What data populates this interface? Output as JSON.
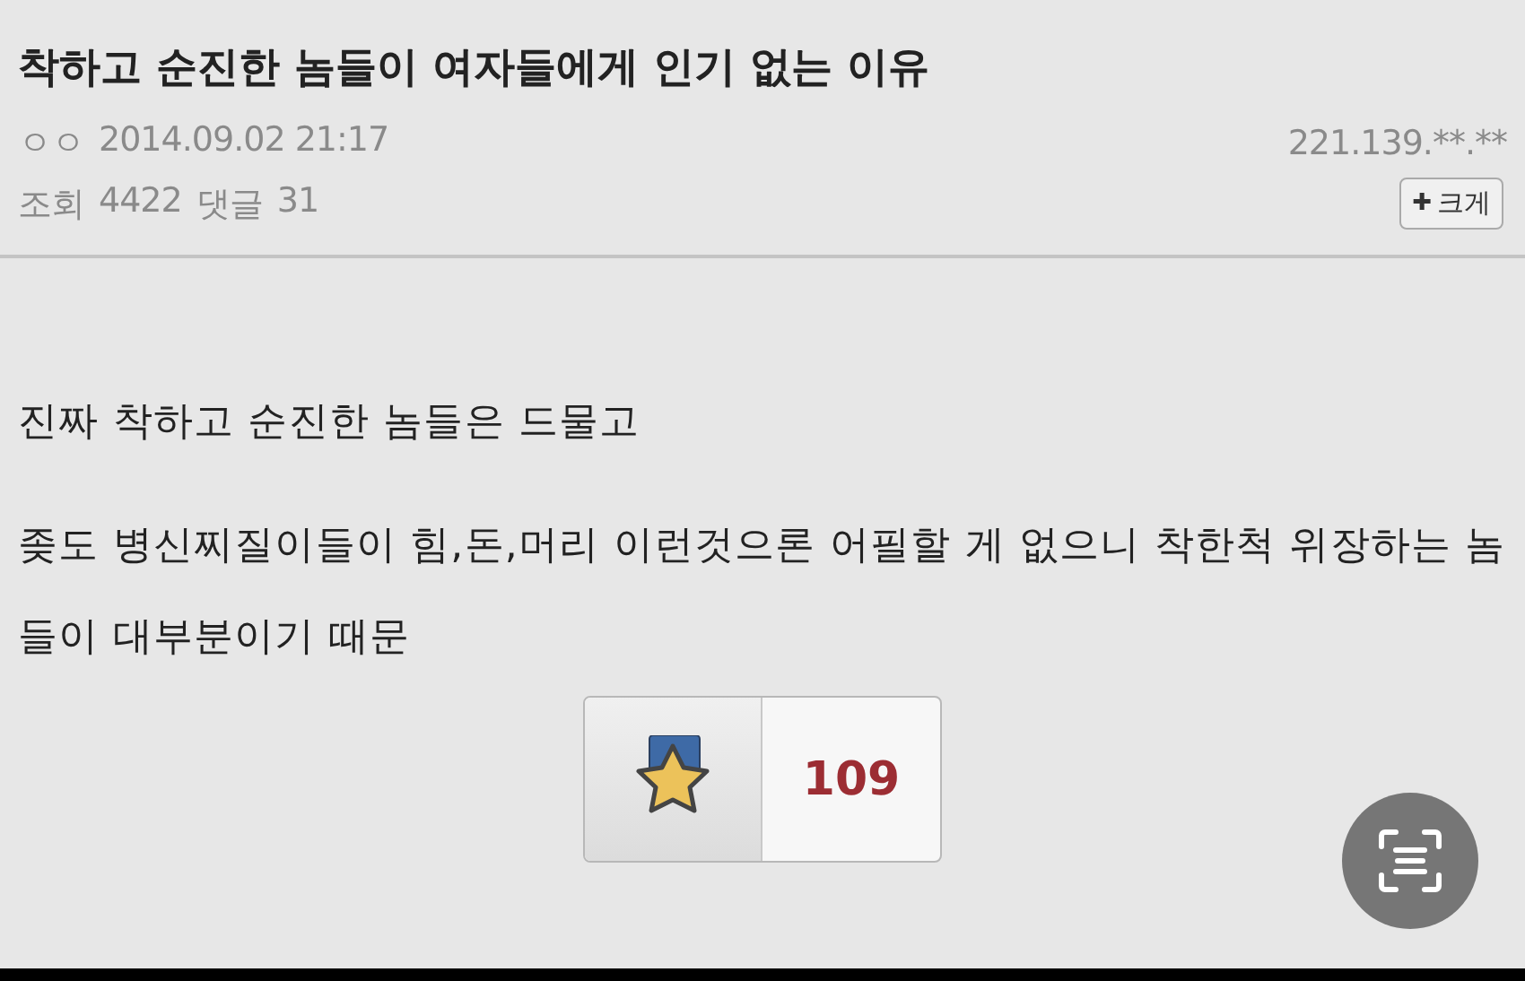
{
  "post": {
    "title": "착하고 순진한 놈들이 여자들에게 인기 없는 이유",
    "author": "ㅇㅇ",
    "datetime": "2014.09.02 21:17",
    "ip": "221.139.**.**",
    "views_label": "조회",
    "views": "4422",
    "comments_label": "댓글",
    "comments": "31",
    "enlarge_button": {
      "icon": "✚",
      "label": "크게"
    }
  },
  "body": [
    "진짜 착하고 순진한 놈들은 드물고",
    "좆도 병신찌질이들이 힘,돈,머리 이런것으론 어필할 게 없으니 착한척 위장하는 놈들이 대부분이기 때문"
  ],
  "recommend": {
    "count": "109"
  }
}
